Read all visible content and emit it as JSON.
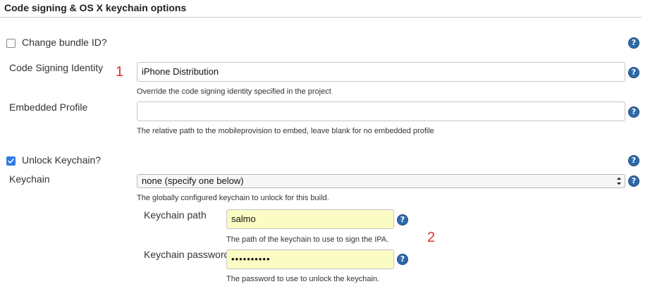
{
  "section": {
    "title": "Code signing & OS X keychain options"
  },
  "change_bundle": {
    "label": "Change bundle ID?",
    "checked": false
  },
  "code_signing": {
    "label": "Code Signing Identity",
    "value": "iPhone Distribution",
    "description": "Override the code signing identity specified in the project"
  },
  "embedded_profile": {
    "label": "Embedded Profile",
    "value": "",
    "description": "The relative path to the mobileprovision to embed, leave blank for no embedded profile"
  },
  "unlock_keychain": {
    "label": "Unlock Keychain?",
    "checked": true
  },
  "keychain": {
    "label": "Keychain",
    "selected": "none (specify one below)",
    "description": "The globally configured keychain to unlock for this build."
  },
  "keychain_path": {
    "label": "Keychain path",
    "value": "salmo",
    "description": "The path of the keychain to use to sign the IPA."
  },
  "keychain_password": {
    "label": "Keychain password",
    "value": "••••••••••",
    "description": "The password to use to unlock the keychain."
  },
  "annotations": {
    "one": "1",
    "two": "2"
  },
  "help_glyph": "?",
  "colors": {
    "help": "#2e6aa8",
    "check": "#2f7ae5",
    "annotation": "#e0302a",
    "input_highlight": "#fbfbc4"
  }
}
